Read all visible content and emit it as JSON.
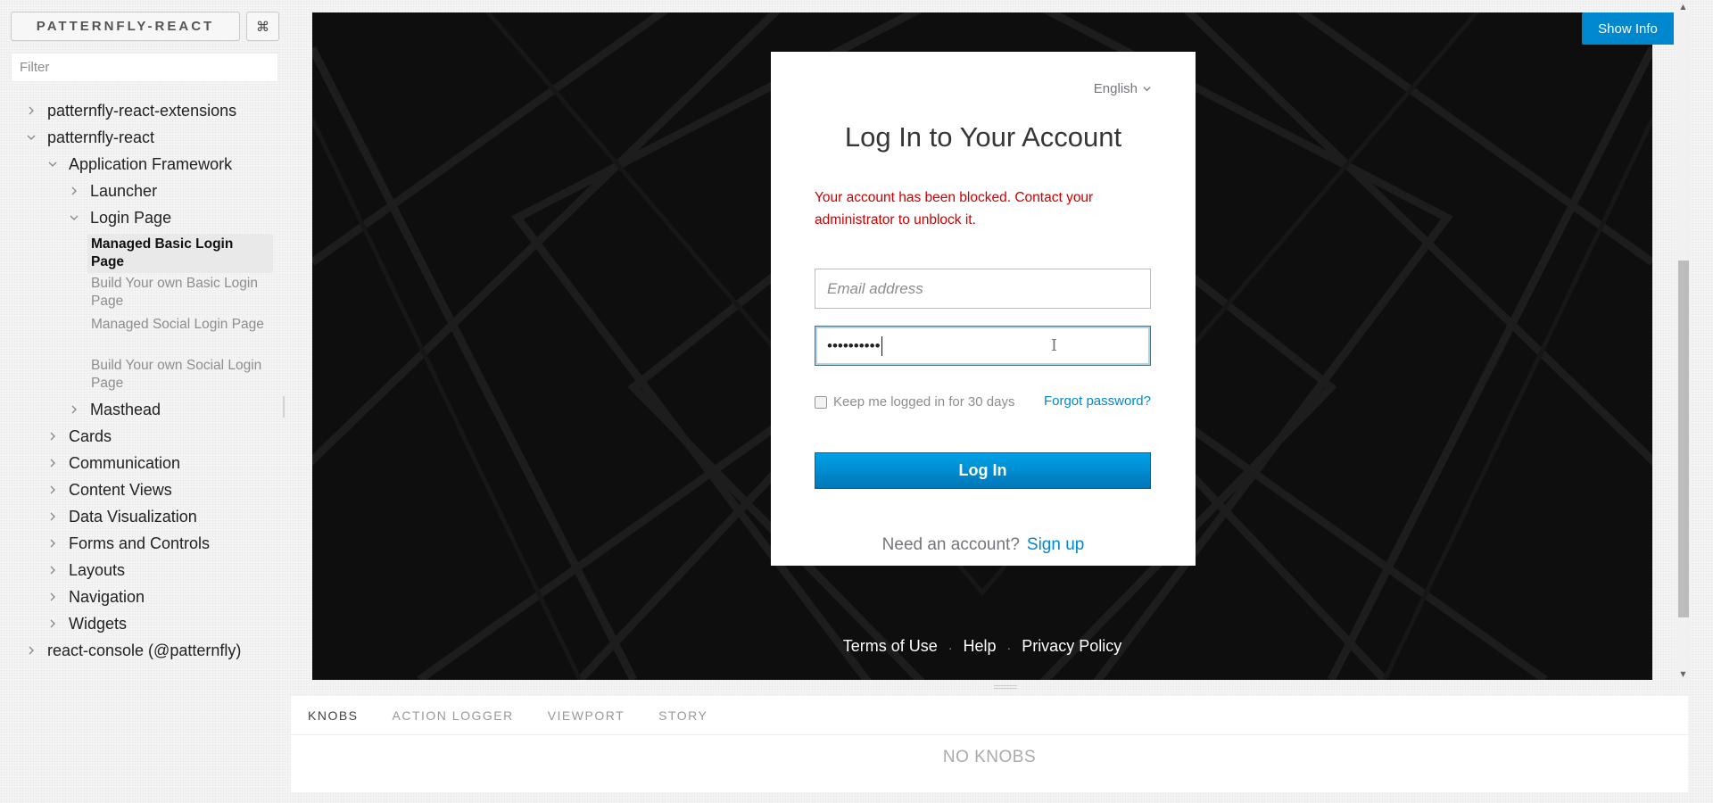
{
  "sidebar": {
    "brand": "PATTERNFLY-REACT",
    "shortcut_glyph": "⌘",
    "filter_placeholder": "Filter",
    "tree": [
      {
        "label": "patternfly-react-extensions",
        "expanded": false
      },
      {
        "label": "patternfly-react",
        "expanded": true
      },
      {
        "label": "Application Framework",
        "expanded": true
      },
      {
        "label": "Launcher",
        "expanded": false
      },
      {
        "label": "Login Page",
        "expanded": true
      },
      {
        "label": "Masthead",
        "expanded": false
      },
      {
        "label": "Cards",
        "expanded": false
      },
      {
        "label": "Communication",
        "expanded": false
      },
      {
        "label": "Content Views",
        "expanded": false
      },
      {
        "label": "Data Visualization",
        "expanded": false
      },
      {
        "label": "Forms and Controls",
        "expanded": false
      },
      {
        "label": "Layouts",
        "expanded": false
      },
      {
        "label": "Navigation",
        "expanded": false
      },
      {
        "label": "Widgets",
        "expanded": false
      },
      {
        "label": "react-console (@patternfly)",
        "expanded": false
      }
    ],
    "stories": [
      {
        "label": "Managed Basic Login Page",
        "active": true
      },
      {
        "label": "Build Your own Basic Login Page",
        "active": false
      },
      {
        "label": "Managed Social Login Page",
        "active": false
      },
      {
        "label": "Build Your own Social Login Page",
        "active": false
      }
    ]
  },
  "preview": {
    "show_info": "Show Info",
    "login": {
      "language": "English",
      "title": "Log In to Your Account",
      "error": "Your account has been blocked. Contact your administrator to unblock it.",
      "email_placeholder": "Email address",
      "password_masked": "••••••••••",
      "remember_label": "Keep me logged in for 30 days",
      "remember_checked": false,
      "forgot_label": "Forgot password?",
      "login_button": "Log In",
      "signup_prompt": "Need an account?",
      "signup_link": "Sign up"
    },
    "footer_links": [
      "Terms of Use",
      "Help",
      "Privacy Policy"
    ]
  },
  "addons": {
    "tabs": [
      "KNOBS",
      "ACTION LOGGER",
      "VIEWPORT",
      "STORY"
    ],
    "active_tab": "KNOBS",
    "empty_message": "NO KNOBS"
  },
  "colors": {
    "accent": "#0088ce",
    "error": "#cc0000",
    "preview_bg": "#0e0e0e"
  }
}
